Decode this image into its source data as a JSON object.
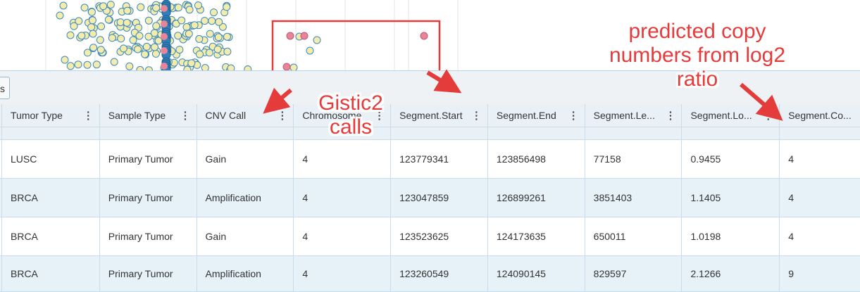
{
  "toolbar": {
    "button_glyph": "s"
  },
  "table": {
    "columns": [
      {
        "label": "Tumor Type"
      },
      {
        "label": "Sample Type"
      },
      {
        "label": "CNV Call"
      },
      {
        "label": "Chromosome"
      },
      {
        "label": "Segment.Start"
      },
      {
        "label": "Segment.End"
      },
      {
        "label": "Segment.Le..."
      },
      {
        "label": "Segment.Lo..."
      },
      {
        "label": "Segment.Co..."
      }
    ],
    "rows": [
      [
        "LUSC",
        "Primary Tumor",
        "Gain",
        "4",
        "123779341",
        "123856498",
        "77158",
        "0.9455",
        "4"
      ],
      [
        "BRCA",
        "Primary Tumor",
        "Amplification",
        "4",
        "123047859",
        "126899261",
        "3851403",
        "1.1405",
        "4"
      ],
      [
        "BRCA",
        "Primary Tumor",
        "Gain",
        "4",
        "123523625",
        "124173635",
        "650011",
        "1.0198",
        "4"
      ],
      [
        "BRCA",
        "Primary Tumor",
        "Amplification",
        "4",
        "123260549",
        "124090145",
        "829597",
        "2.1266",
        "9"
      ]
    ]
  },
  "annotations": {
    "gistic_line1": "Gistic2",
    "gistic_line2": "calls",
    "predicted_line1": "predicted copy",
    "predicted_line2": "numbers from log2",
    "predicted_line3": "ratio"
  },
  "colors": {
    "annotation": "#e43b3b",
    "row_alt": "#e6f2f8",
    "header": "#e9f1f7",
    "dot_yellow": "#f3ecaa",
    "dot_blue_stroke": "#3b88c4",
    "dot_red": "#e8849a"
  }
}
